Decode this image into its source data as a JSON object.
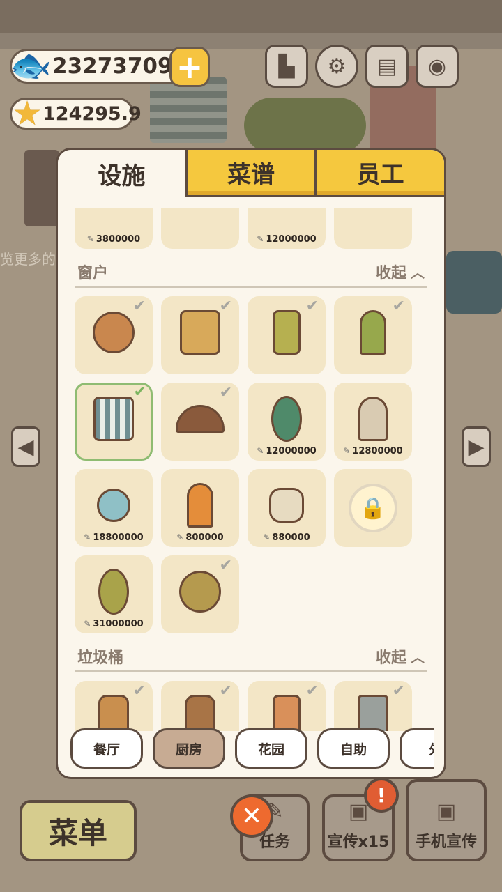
{
  "currency": {
    "fish": "23273709",
    "stars": "124295.9"
  },
  "side_text": "览更多的",
  "tabs": [
    "设施",
    "菜谱",
    "员工"
  ],
  "top_partial_items": [
    "3800000",
    "",
    "12000000",
    ""
  ],
  "sections": {
    "windows": {
      "title": "窗户",
      "collapse": "收起",
      "items": [
        {
          "owned": true,
          "price": ""
        },
        {
          "owned": true,
          "price": ""
        },
        {
          "owned": true,
          "price": ""
        },
        {
          "owned": true,
          "price": ""
        },
        {
          "owned": true,
          "price": "",
          "selected": true
        },
        {
          "owned": true,
          "price": ""
        },
        {
          "owned": false,
          "price": "12000000"
        },
        {
          "owned": false,
          "price": "12800000"
        },
        {
          "owned": false,
          "price": "18800000"
        },
        {
          "owned": false,
          "price": "800000"
        },
        {
          "owned": false,
          "price": "880000"
        },
        {
          "owned": false,
          "price": "",
          "locked": true
        },
        {
          "owned": false,
          "price": "31000000"
        },
        {
          "owned": true,
          "price": ""
        }
      ]
    },
    "trash": {
      "title": "垃圾桶",
      "collapse": "收起"
    }
  },
  "categories": [
    "餐厅",
    "厨房",
    "花园",
    "自助",
    "外"
  ],
  "active_category": "厨房",
  "bottom": {
    "menu": "菜单",
    "task": "任务",
    "promo": "宣传x15",
    "phone": "手机宣传"
  },
  "colors": {
    "panel": "#fbf6ec",
    "tab_yellow": "#f5c83e",
    "cell": "#f3e6c6",
    "selected_border": "#8fbc72",
    "close": "#ee6a2f"
  }
}
